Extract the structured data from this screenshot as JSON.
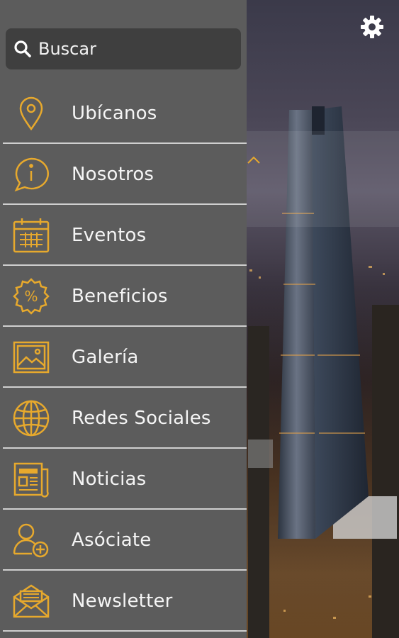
{
  "colors": {
    "drawer_bg": "#5c5c5c",
    "search_bg": "#3f3f3f",
    "icon_accent": "#e7a92d",
    "text": "#f5f5f5"
  },
  "search": {
    "placeholder": "Buscar",
    "icon": "search-icon"
  },
  "header": {
    "settings_icon": "gear-icon"
  },
  "menu": {
    "items": [
      {
        "label": "Ubícanos",
        "icon": "location-pin-icon"
      },
      {
        "label": "Nosotros",
        "icon": "info-bubble-icon"
      },
      {
        "label": "Eventos",
        "icon": "calendar-icon"
      },
      {
        "label": "Beneficios",
        "icon": "percent-badge-icon"
      },
      {
        "label": "Galería",
        "icon": "image-gallery-icon"
      },
      {
        "label": "Redes Sociales",
        "icon": "globe-icon"
      },
      {
        "label": "Noticias",
        "icon": "newspaper-icon"
      },
      {
        "label": "Asóciate",
        "icon": "add-user-icon"
      },
      {
        "label": "Newsletter",
        "icon": "envelope-icon"
      }
    ]
  }
}
